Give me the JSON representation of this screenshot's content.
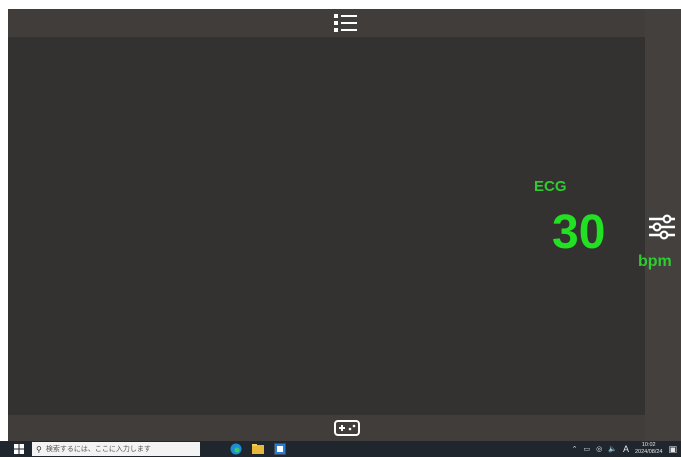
{
  "monitor": {
    "signal_label": "ECG",
    "heart_rate": "30",
    "heart_rate_unit": "bpm"
  },
  "colors": {
    "accent_green": "#22e022",
    "panel_bg": "#333231",
    "bar_bg": "#403d3a"
  },
  "icons": {
    "menu": "list-menu-icon",
    "settings": "sliders-icon",
    "controller": "gamepad-icon"
  },
  "taskbar": {
    "search_placeholder": "検索するには、ここに入力します",
    "input_indicator": "A",
    "time": "10:02",
    "date": "2024/08/24"
  }
}
